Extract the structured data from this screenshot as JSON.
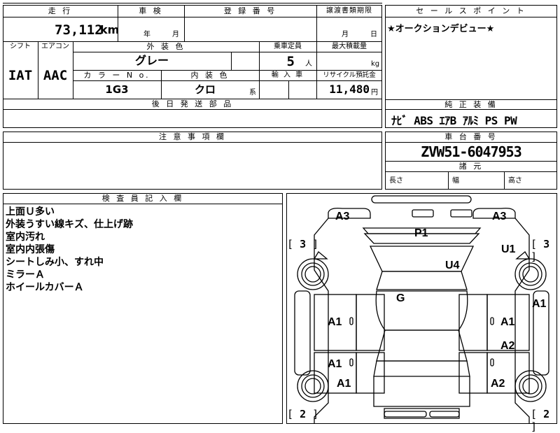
{
  "top_table": {
    "headers": {
      "mileage": "走 行",
      "inspection": "車 検",
      "registration_number": "登 録 番 号",
      "transfer_deadline": "譲渡書類期限",
      "shift": "シフト",
      "aircon": "エアコン",
      "exterior_color": "外 装 色",
      "capacity": "乗車定員",
      "max_load": "最大積載量",
      "color_no": "カ ラ ー N o.",
      "interior_color": "内 装 色",
      "import_car": "輸 入 車",
      "recycle_deposit": "リサイクル預託金",
      "later_parts": "後 日 発 送 部 品"
    },
    "mileage_value": "73,112",
    "mileage_unit": "km",
    "inspection_year": "年",
    "inspection_month": "月",
    "transfer_month": "月",
    "transfer_day": "日",
    "shift_value": "IAT",
    "aircon_value": "AAC",
    "exterior_color_value": "グレー",
    "capacity_value": "5",
    "capacity_unit": "人",
    "max_load_unit": "kg",
    "color_no_value": "1G3",
    "interior_color_value": "クロ",
    "interior_color_suffix": "系",
    "recycle_value": "11,480",
    "recycle_unit": "円"
  },
  "sales_point": {
    "header": "セ ー ル ス ポ イ ン ト",
    "text": "★オークションデビュー★"
  },
  "equipment": {
    "header": "純 正 装 備",
    "text": "ﾅﾋﾞ ABS ｴｱB ｱﾙﾐ PS PW"
  },
  "notes": {
    "header": "注 意 事 項 欄"
  },
  "chassis": {
    "header": "車 台 番 号",
    "value": "ZVW51-6047953"
  },
  "dimensions": {
    "header": "諸 元",
    "length": "長さ",
    "width": "幅",
    "height": "高さ"
  },
  "inspector": {
    "header": "検 査 員 記 入 欄",
    "lines": [
      "上面Ｕ多い",
      "外装うすい線キズ、仕上げ跡",
      "室内汚れ",
      "室内内張傷",
      "シートしみ小、すれ中",
      "ミラーＡ",
      "ホイールカバーＡ"
    ]
  },
  "diagram": {
    "marks": {
      "a3_left": "A3",
      "a3_right": "A3",
      "p1": "P1",
      "u1": "U1",
      "u4": "U4",
      "g": "G",
      "a1_right_side": "A1",
      "a1_left_front_door": "A1",
      "a1_right_front_door": "A1",
      "a2_right_rear_door": "A2",
      "a1_left_rear_door": "A1",
      "a1_left_rear": "A1",
      "a2_right_rear": "A2"
    },
    "tire_left_top": "3",
    "tire_right_top": "3",
    "tire_left_bottom": "2",
    "tire_right_bottom": "2"
  }
}
